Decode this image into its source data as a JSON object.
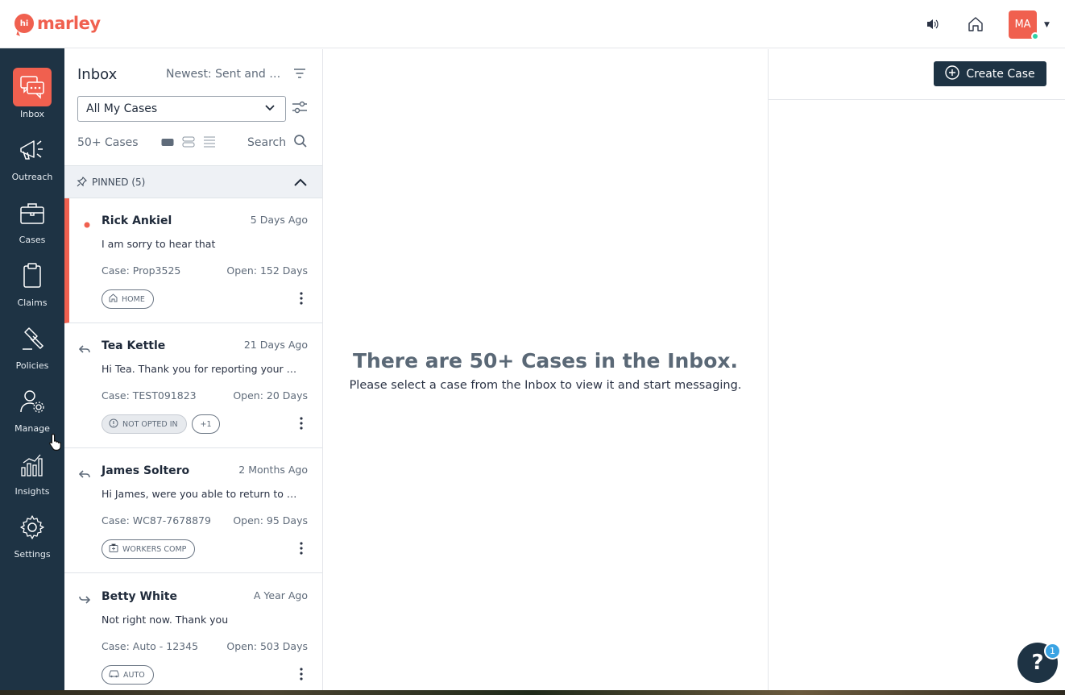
{
  "brand": {
    "logo_mark": "hi",
    "logo_text": "marley",
    "color": "#f0604f"
  },
  "topbar": {
    "icons": [
      "speaker-icon",
      "home-icon"
    ],
    "avatar_initials": "MA",
    "avatar_status_color": "#2fd2a6"
  },
  "leftnav": {
    "items": [
      {
        "label": "Inbox",
        "icon": "chat-icon",
        "active": true
      },
      {
        "label": "Outreach",
        "icon": "megaphone-icon",
        "active": false
      },
      {
        "label": "Cases",
        "icon": "briefcase-icon",
        "active": false
      },
      {
        "label": "Claims",
        "icon": "clipboard-icon",
        "active": false
      },
      {
        "label": "Policies",
        "icon": "gavel-icon",
        "active": false
      },
      {
        "label": "Manage",
        "icon": "user-gear-icon",
        "active": false
      },
      {
        "label": "Insights",
        "icon": "bar-chart-icon",
        "active": false
      },
      {
        "label": "Settings",
        "icon": "gear-icon",
        "active": false
      }
    ]
  },
  "inbox": {
    "title": "Inbox",
    "sort_label": "Newest: Sent and Re...",
    "case_filter": "All My Cases",
    "count_label": "50+ Cases",
    "search_label": "Search",
    "pinned_label": "PINNED (5)",
    "cases": [
      {
        "name": "Rick Ankiel",
        "time": "5 Days Ago",
        "message": "I am sorry to hear that",
        "case_id": "Case: Prop3525",
        "open": "Open: 152 Days",
        "tag": "HOME",
        "tag_icon": "home-icon",
        "status": "unread"
      },
      {
        "name": "Tea Kettle",
        "time": "21 Days Ago",
        "message": "Hi Tea. Thank you for reporting your claim...",
        "case_id": "Case: TEST091823",
        "open": "Open: 20 Days",
        "tag": "NOT OPTED IN",
        "tag_icon": "alert-icon",
        "extra": "+1",
        "status": "replied"
      },
      {
        "name": "James Soltero",
        "time": "2 Months Ago",
        "message": "Hi James, were you able to return to work...",
        "case_id": "Case: WC87-7678879",
        "open": "Open: 95 Days",
        "tag": "WORKERS COMP",
        "tag_icon": "medkit-icon",
        "status": "replied"
      },
      {
        "name": "Betty White",
        "time": "A Year Ago",
        "message": "Not right now. Thank you",
        "case_id": "Case: Auto - 12345",
        "open": "Open: 503 Days",
        "tag": "AUTO",
        "tag_icon": "car-icon",
        "status": "forwarded"
      }
    ]
  },
  "center": {
    "empty_title": "There are 50+ Cases in the Inbox.",
    "empty_subtitle": "Please select a case from the Inbox to view it and start messaging."
  },
  "right": {
    "create_button": "Create Case"
  },
  "help": {
    "label": "?",
    "badge": "1"
  }
}
